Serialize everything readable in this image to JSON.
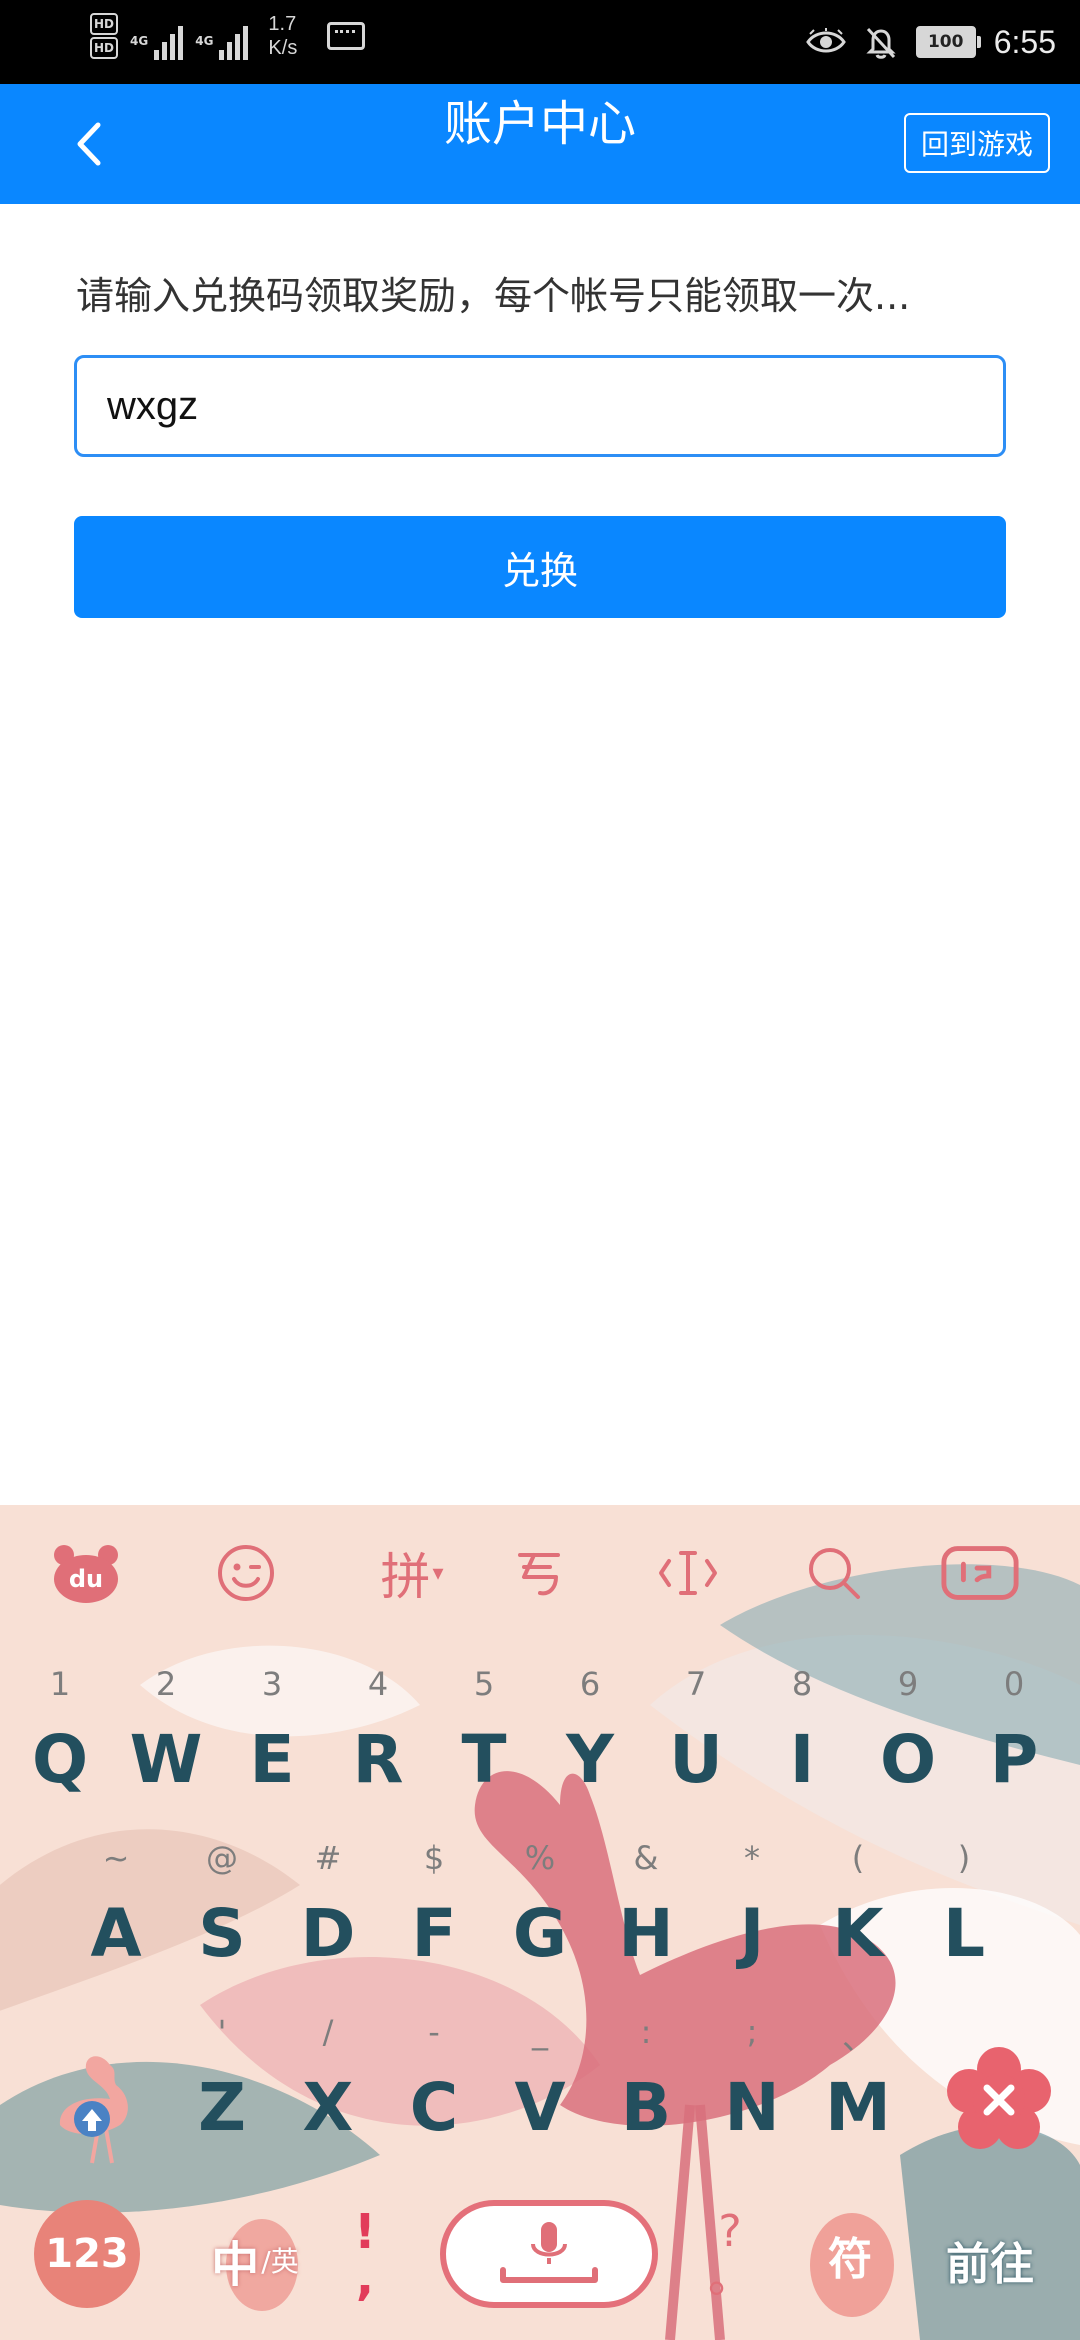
{
  "status_bar": {
    "network_top": "HD",
    "network_bottom": "HD",
    "sim1": "4G",
    "sim2": "4G",
    "speed_value": "1.7",
    "speed_unit": "K/s",
    "battery": "100",
    "time": "6:55",
    "icons": [
      "eye-icon",
      "bell-off-icon",
      "keyboard-icon"
    ]
  },
  "app_bar": {
    "title": "账户中心",
    "return_label": "回到游戏",
    "color": "#0a87ff"
  },
  "redeem": {
    "prompt": "请输入兑换码领取奖励，每个帐号只能领取一次...",
    "input_value": "wxgz",
    "button_label": "兑换"
  },
  "keyboard": {
    "toolbar": {
      "du_label": "du",
      "pinyin_label": "拼"
    },
    "row1": [
      {
        "hint": "1",
        "letter": "Q"
      },
      {
        "hint": "2",
        "letter": "W"
      },
      {
        "hint": "3",
        "letter": "E"
      },
      {
        "hint": "4",
        "letter": "R"
      },
      {
        "hint": "5",
        "letter": "T"
      },
      {
        "hint": "6",
        "letter": "Y"
      },
      {
        "hint": "7",
        "letter": "U"
      },
      {
        "hint": "8",
        "letter": "I"
      },
      {
        "hint": "9",
        "letter": "O"
      },
      {
        "hint": "0",
        "letter": "P"
      }
    ],
    "row2": [
      {
        "hint": "~",
        "letter": "A"
      },
      {
        "hint": "@",
        "letter": "S"
      },
      {
        "hint": "#",
        "letter": "D"
      },
      {
        "hint": "$",
        "letter": "F"
      },
      {
        "hint": "%",
        "letter": "G"
      },
      {
        "hint": "&",
        "letter": "H"
      },
      {
        "hint": "*",
        "letter": "J"
      },
      {
        "hint": "(",
        "letter": "K"
      },
      {
        "hint": ")",
        "letter": "L"
      }
    ],
    "row3": [
      {
        "hint": "'",
        "letter": "Z"
      },
      {
        "hint": "/",
        "letter": "X"
      },
      {
        "hint": "-",
        "letter": "C"
      },
      {
        "hint": "_",
        "letter": "V"
      },
      {
        "hint": ":",
        "letter": "B"
      },
      {
        "hint": ";",
        "letter": "N"
      },
      {
        "hint": "、",
        "letter": "M"
      }
    ],
    "bottom": {
      "num_label": "123",
      "lang_big": "中",
      "lang_small": "/英",
      "punct_top": "!",
      "punct_bottom": ",",
      "q_top": "?",
      "q_bottom": "。",
      "sym_label": "符",
      "enter_label": "前往"
    },
    "colors": {
      "letter": "#234f5e",
      "accent": "#e06f78",
      "background": "#f8e0d5"
    }
  }
}
